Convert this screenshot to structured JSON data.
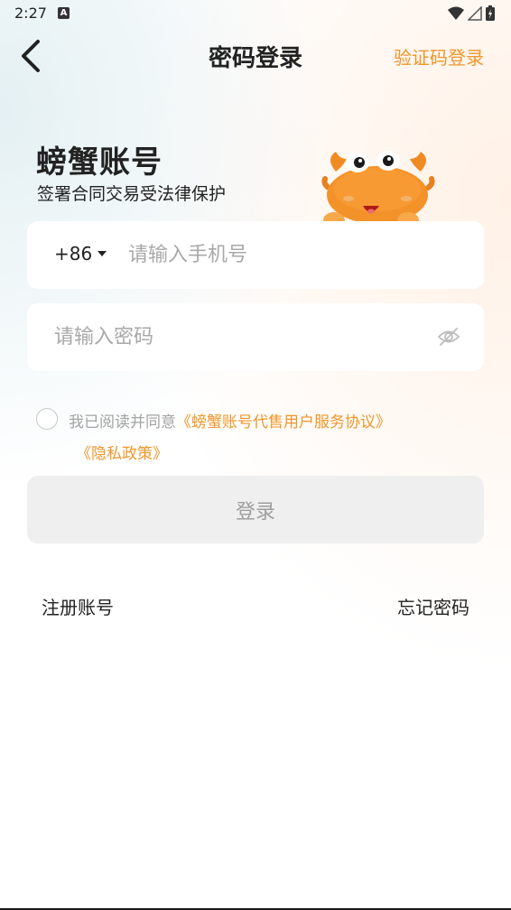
{
  "status_bar": {
    "time": "2:27",
    "notification_badge": "A"
  },
  "nav": {
    "title": "密码登录",
    "right_link": "验证码登录"
  },
  "brand": {
    "title": "螃蟹账号",
    "subtitle": "签署合同交易受法律保护"
  },
  "phone": {
    "country_code": "+86",
    "placeholder": "请输入手机号"
  },
  "password": {
    "placeholder": "请输入密码"
  },
  "agreement": {
    "prefix": "我已阅读并同意",
    "service_link": "《螃蟹账号代售用户服务协议》",
    "privacy_link": "《隐私政策》",
    "checked": false
  },
  "login_button": "登录",
  "footer_links": {
    "register": "注册账号",
    "forgot": "忘记密码"
  },
  "colors": {
    "accent": "#f0962a",
    "button_bg": "#efefef",
    "placeholder": "#a8a8a8"
  }
}
